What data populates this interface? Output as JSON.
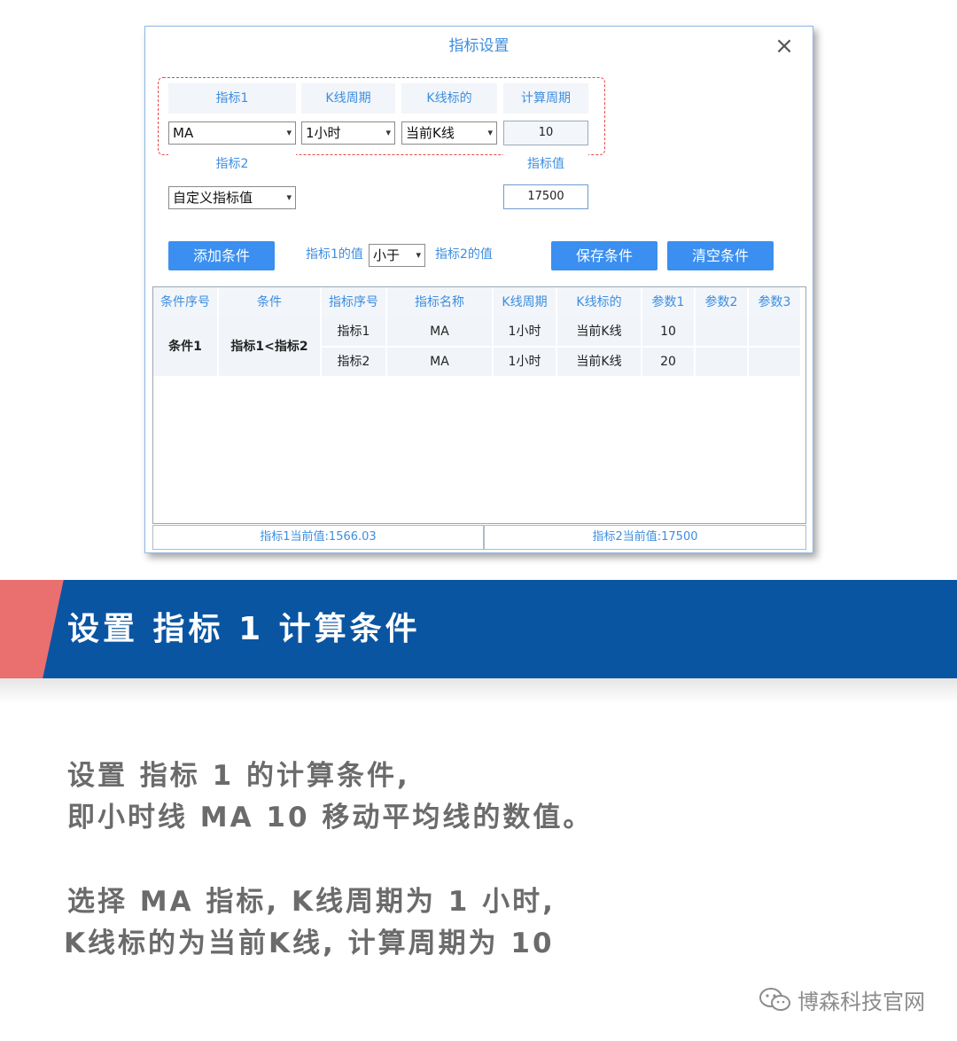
{
  "dialog": {
    "title": "指标设置",
    "indicator1": {
      "head": "指标1",
      "value": "MA",
      "kline_period_head": "K线周期",
      "kline_period": "1小时",
      "kline_target_head": "K线标的",
      "kline_target": "当前K线",
      "calc_period_head": "计算周期",
      "calc_period": "10"
    },
    "indicator2": {
      "head": "指标2",
      "value": "自定义指标值",
      "value_head": "指标值",
      "custom_value": "17500"
    },
    "condition_bar": {
      "add_button": "添加条件",
      "left_label": "指标1的值",
      "operator": "小于",
      "right_label": "指标2的值",
      "save_button": "保存条件",
      "clear_button": "清空条件"
    },
    "table": {
      "columns": [
        "条件序号",
        "条件",
        "指标序号",
        "指标名称",
        "K线周期",
        "K线标的",
        "参数1",
        "参数2",
        "参数3"
      ],
      "condition_id": "条件1",
      "condition": "指标1<指标2",
      "rows": [
        {
          "index": "指标1",
          "name": "MA",
          "period": "1小时",
          "target": "当前K线",
          "p1": "10",
          "p2": "",
          "p3": ""
        },
        {
          "index": "指标2",
          "name": "MA",
          "period": "1小时",
          "target": "当前K线",
          "p1": "20",
          "p2": "",
          "p3": ""
        }
      ]
    },
    "footer": {
      "current1": "指标1当前值:1566.03",
      "current2": "指标2当前值:17500"
    }
  },
  "banner": {
    "title": "设置 指标 1 计算条件"
  },
  "paragraphs": {
    "p1_line1": "设置 指标 1 的计算条件,",
    "p1_line2": "即小时线 MA 10 移动平均线的数值。",
    "p2_line1": "选择 MA 指标, K线周期为 1 小时,",
    "p2_line2": "K线标的为当前K线, 计算周期为 10"
  },
  "watermark": {
    "text": "博森科技官网",
    "icon": "wechat-icon"
  },
  "colors": {
    "accent_blue": "#3a8ff0",
    "banner_blue": "#0a55a2",
    "banner_red": "#ea6f6f",
    "highlight_red": "#e5484d"
  }
}
